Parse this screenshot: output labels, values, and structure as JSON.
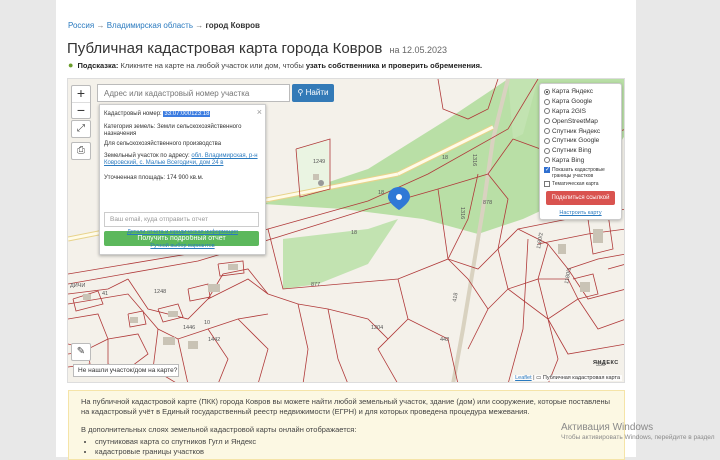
{
  "breadcrumb": {
    "items": [
      "Россия",
      "Владимирская область",
      "город Ковров"
    ],
    "separator": "→"
  },
  "title": {
    "text": "Публичная кадастровая карта города Ковров",
    "suffix": "на 12.05.2023"
  },
  "hint": {
    "label": "Подсказка:",
    "text": "Кликните на карте на любой участок или дом, чтобы",
    "bold": "узать собственника и проверить обременения."
  },
  "map": {
    "search_placeholder": "Адрес или кадастровый номер участка",
    "find_button": "Найти",
    "zoom_in": "+",
    "zoom_out": "−",
    "not_found_button": "Не нашли участок/дом на карте?",
    "attribution_leaflet": "Leaflet",
    "attribution_separator": "|",
    "attribution_text": "Публичная кадастровая карта",
    "yandex_logo": "ЯНДЕКС",
    "parcel_labels": [
      "18",
      "18",
      "1316",
      "1249",
      "878",
      "1316",
      "877",
      "1204",
      "442",
      "1446",
      "1442",
      "1180/2",
      "1180/1",
      "418",
      "1248",
      "ДИЧИ",
      "41",
      "18",
      "10",
      "359"
    ],
    "popup": {
      "close": "×",
      "cad_label": "Кадастровый номер:",
      "cad_value": "33:07:000123:18",
      "category_label": "Категория земель:",
      "category_value": "Земли сельскохозяйственного назначения",
      "usage_value": "Для сельскохозяйственного производства",
      "address_label": "Земельный участок по адресу:",
      "address_value": "обл. Владимирская, р-н Ковровский, с. Малые Всегодичи, дом 24 в",
      "area_label": "Уточненная площадь:",
      "area_value": "174 900 кв.м.",
      "email_placeholder": "Ваш email, куда отправить отчет",
      "report_button": "Получить подробный отчет",
      "details_link": "Детали отчета и юридическая информация",
      "manual_link": "Ручной выбор вариантов"
    },
    "layers": {
      "options": [
        {
          "label": "Карта Яндекс",
          "selected": true
        },
        {
          "label": "Карта Google",
          "selected": false
        },
        {
          "label": "Карта 2GIS",
          "selected": false
        },
        {
          "label": "OpenStreetMap",
          "selected": false
        },
        {
          "label": "Спутник Яндекс",
          "selected": false
        },
        {
          "label": "Спутник Google",
          "selected": false
        },
        {
          "label": "Спутник Bing",
          "selected": false
        },
        {
          "label": "Карта Bing",
          "selected": false
        }
      ],
      "checkbox_boundaries": {
        "label": "Показать кадастровые границы участков",
        "checked": true
      },
      "checkbox_thematic": {
        "label": "Тематическая карта",
        "checked": false
      },
      "share_button": "Поделиться ссылкой",
      "setup_link": "Настроить карту"
    }
  },
  "info": {
    "p1": "На публичной кадастровой карте (ПКК) города Ковров вы можете найти любой земельный участок, здание (дом) или сооружение, которые поставлены на кадастровый учёт в Единый государственный реестр недвижимости (ЕГРН) и для которых проведена процедура межевания.",
    "p2": "В дополнительных слоях земельной кадастровой карты онлайн отображается:",
    "list": [
      "спутниковая карта со спутников Гугл и Яндекс",
      "кадастровые границы участков"
    ]
  },
  "windows_watermark": {
    "line1": "Активация Windows",
    "line2": "Чтобы активировать Windows, перейдите в раздел"
  },
  "colors": {
    "accent_blue": "#337ab7",
    "report_green": "#5cb85c",
    "share_red": "#d9534f",
    "parcel_border": "#b03a3a",
    "green_area": "#b9dfa6"
  }
}
